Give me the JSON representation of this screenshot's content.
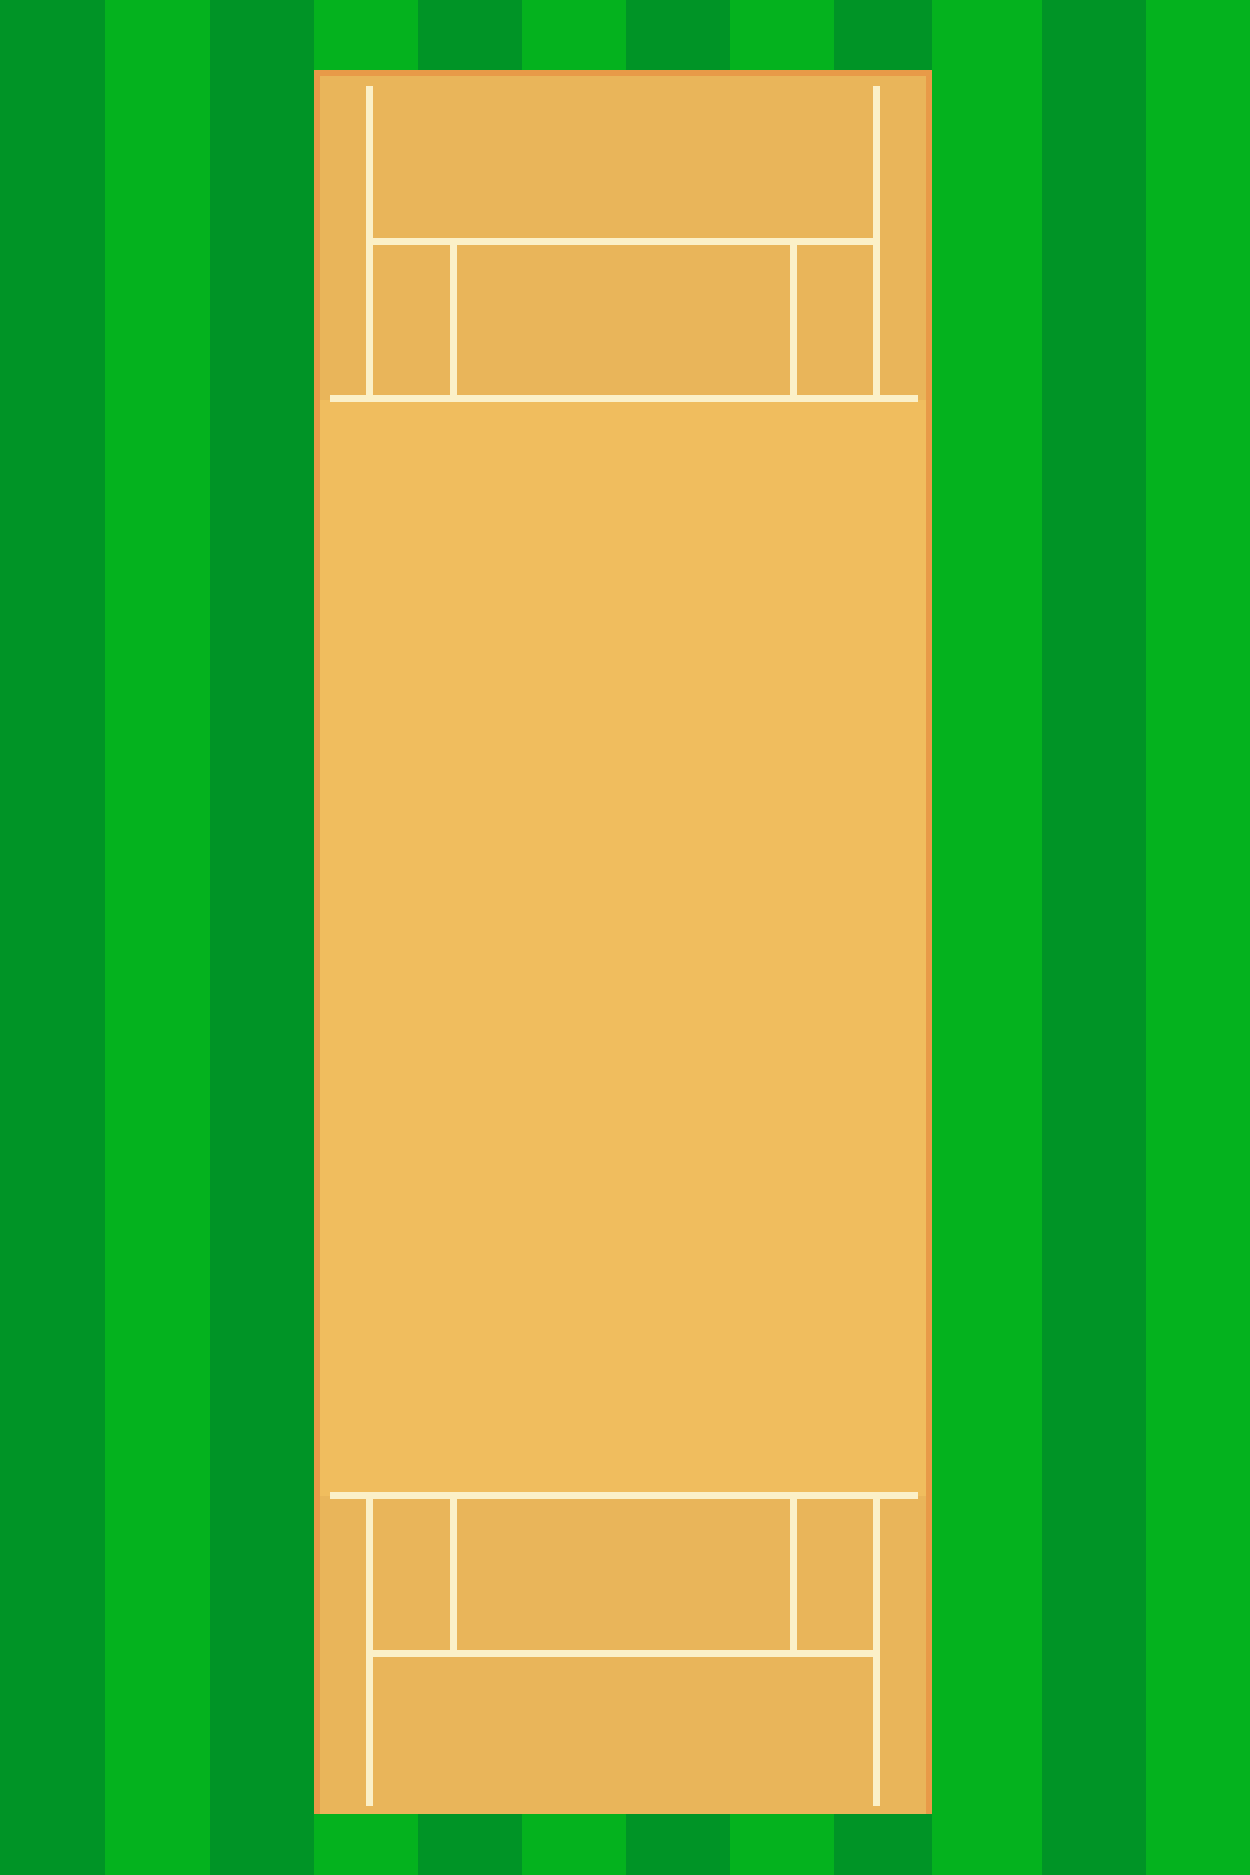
{
  "scene": "cricket-pitch-top-view",
  "colors": {
    "grass_dark": "#009426",
    "grass_light": "#04b21e",
    "pitch_fill": "#f0bd5e",
    "pitch_end_fill": "#e9b55a",
    "pitch_border": "#e89a48",
    "crease_lines": "#fbf0c8"
  },
  "elements": {
    "outfield": "grass-stripes",
    "pitch": "pitch",
    "top_end": "top-crease-area",
    "bottom_end": "bottom-crease-area"
  }
}
